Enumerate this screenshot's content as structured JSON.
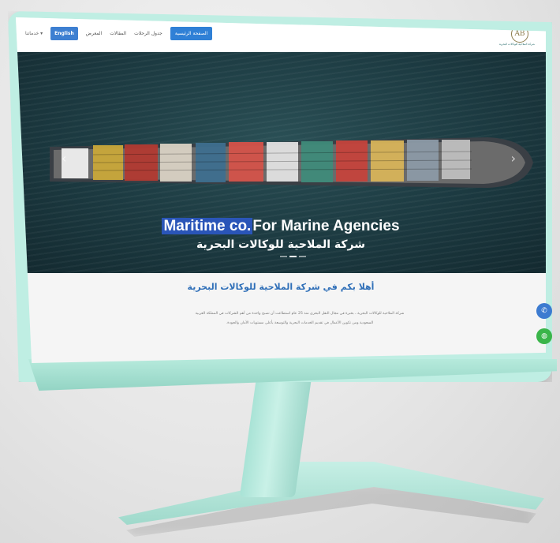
{
  "nav": {
    "logo_mark": "AB",
    "logo_text": "شركة الملاحية للوكالات البحرية",
    "items": [
      {
        "label": "خدماتنا",
        "dropdown": true
      },
      {
        "label": "English"
      },
      {
        "label": "المعرض"
      },
      {
        "label": "المقالات"
      },
      {
        "label": "جدول الرحلات"
      },
      {
        "label": "الصفحة الرئيسية",
        "active": true
      }
    ]
  },
  "hero": {
    "title_highlight": "Maritime co.",
    "title_rest": "For Marine Agencies",
    "subtitle": "شركة الملاحية للوكالات البحرية",
    "prev_icon": "chevron-left-icon",
    "next_icon": "chevron-right-icon"
  },
  "welcome": {
    "heading": "أهلا بكم في شركة الملاحية للوكالات البحرية",
    "paragraph": "شركة الملاحية للوكالات البحرية ، بخبرة في مجال النقل البحري منذ 25 عام استطاعت أن تصبح واحدة من أهم الشركات في المملكة العربية السعودية ومن تكوين الأعمال في تقديم الخدمات البحرية والتوسعة بأعلى مستويات الأمان والجودة."
  },
  "floating": {
    "phone_icon": "phone-icon",
    "whatsapp_icon": "whatsapp-icon"
  },
  "colors": {
    "frame": "#bfeee3",
    "primary": "#2f80d6",
    "whatsapp": "#3ab54a"
  }
}
